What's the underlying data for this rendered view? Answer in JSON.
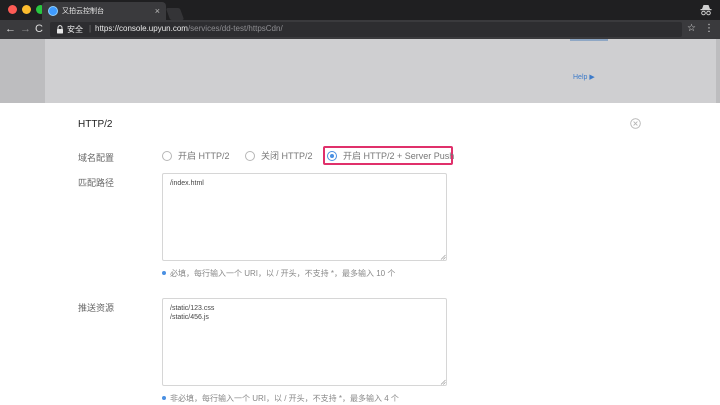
{
  "browser": {
    "tab_title": "又拍云控制台",
    "tab_close": "×",
    "secure_label": "安全",
    "url_host": "https://console.upyun.com",
    "url_path": "/services/dd-test/httpsCdn/",
    "nav": {
      "back": "←",
      "forward": "→",
      "reload": "C"
    },
    "star": "☆",
    "menu": "⋮"
  },
  "background": {
    "help_link": "Help ▶"
  },
  "modal": {
    "title": "HTTP/2",
    "domain_config": {
      "label": "域名配置",
      "options": [
        {
          "label": "开启 HTTP/2",
          "selected": false
        },
        {
          "label": "关闭 HTTP/2",
          "selected": false
        },
        {
          "label": "开启 HTTP/2 + Server Push",
          "selected": true
        }
      ]
    },
    "match_path": {
      "label": "匹配路径",
      "value": "/index.html",
      "hint": "必填，每行输入一个 URI，以 / 开头，不支持 *，最多输入 10 个"
    },
    "push_resources": {
      "label": "推送资源",
      "value": "/static/123.css\n/static/456.js",
      "hint": "非必填，每行输入一个 URI，以 / 开头，不支持 *，最多输入 4 个"
    }
  },
  "colors": {
    "accent": "#4a90e2",
    "highlight": "#e0306b",
    "backdrop": "#bdbdbf"
  }
}
